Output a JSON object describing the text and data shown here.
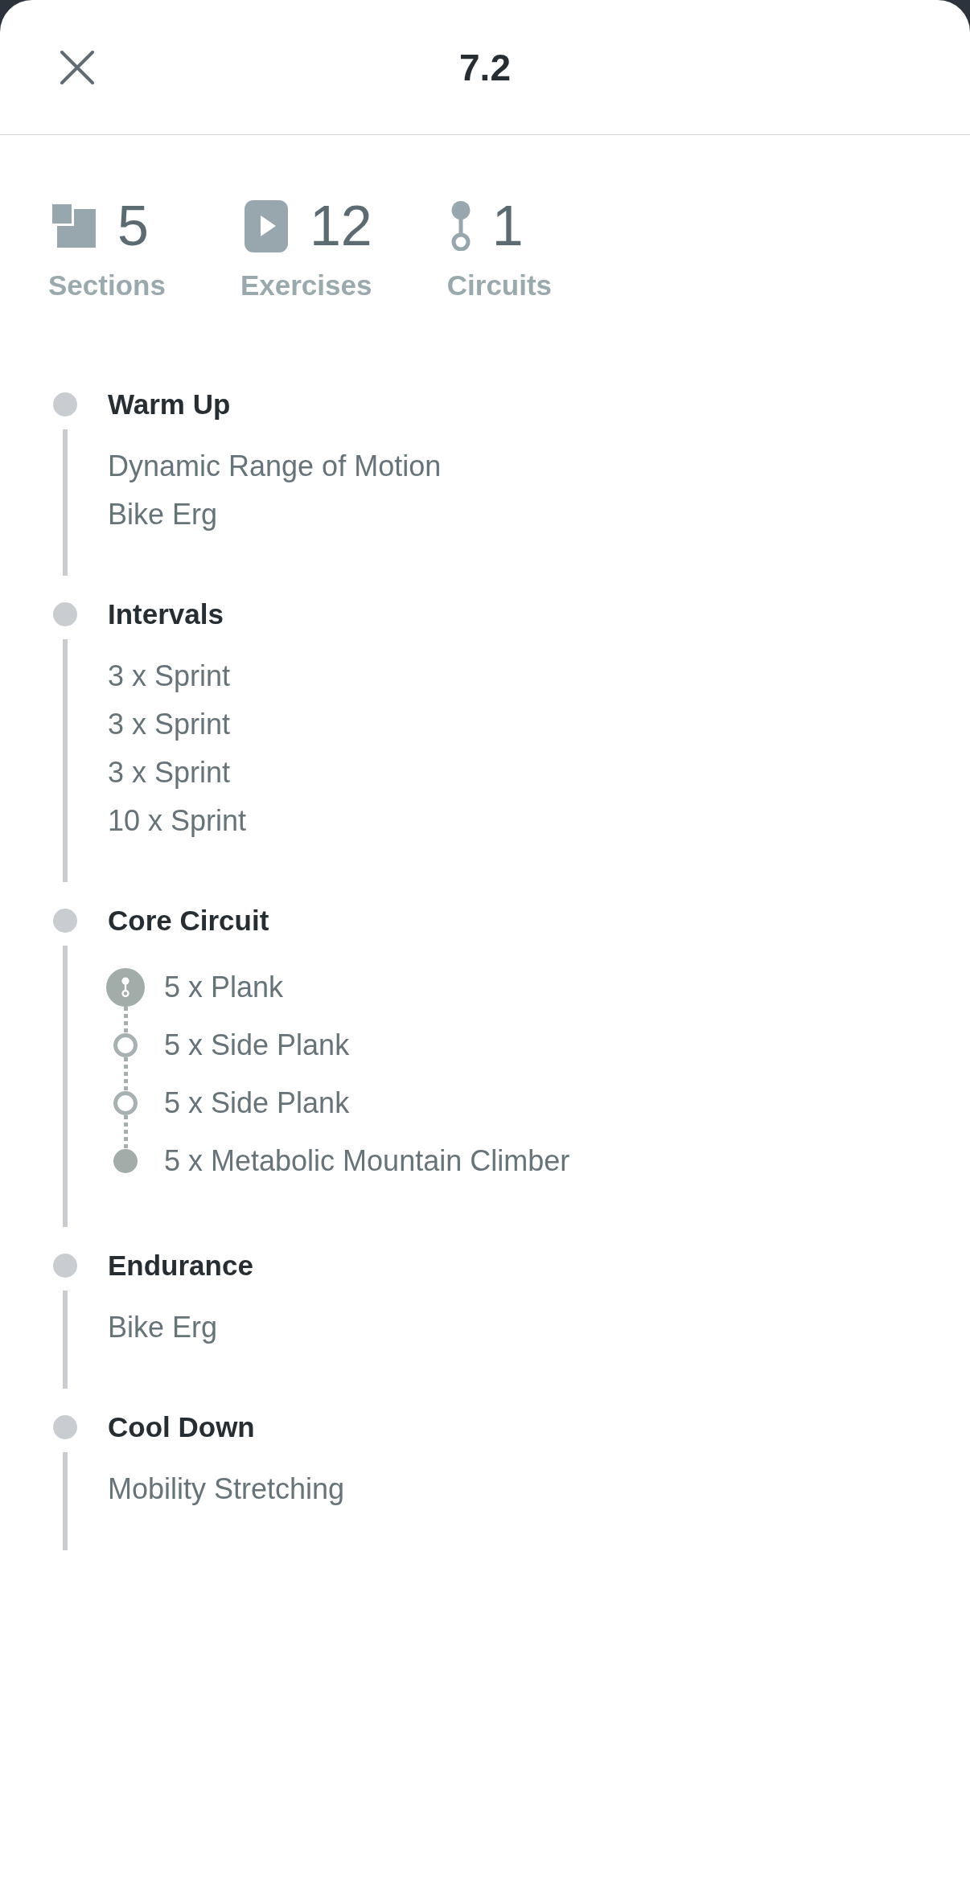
{
  "header": {
    "title": "7.2"
  },
  "stats": [
    {
      "kind": "sections",
      "count": "5",
      "label": "Sections"
    },
    {
      "kind": "exercises",
      "count": "12",
      "label": "Exercises"
    },
    {
      "kind": "circuits",
      "count": "1",
      "label": "Circuits"
    }
  ],
  "sections": [
    {
      "title": "Warm Up",
      "items": [
        {
          "kind": "exercise",
          "name": "Dynamic Range of Motion"
        },
        {
          "kind": "exercise",
          "name": "Bike Erg"
        }
      ]
    },
    {
      "title": "Intervals",
      "items": [
        {
          "kind": "exercise",
          "name": "3 x Sprint"
        },
        {
          "kind": "exercise",
          "name": "3 x Sprint"
        },
        {
          "kind": "exercise",
          "name": "3 x Sprint"
        },
        {
          "kind": "exercise",
          "name": "10 x Sprint"
        }
      ]
    },
    {
      "title": "Core Circuit",
      "items": [
        {
          "kind": "circuit-start",
          "name": "5 x Plank"
        },
        {
          "kind": "circuit-middle",
          "name": "5 x Side Plank"
        },
        {
          "kind": "circuit-middle",
          "name": "5 x Side Plank"
        },
        {
          "kind": "circuit-end",
          "name": "5 x Metabolic Mountain Climber"
        }
      ]
    },
    {
      "title": "Endurance",
      "items": [
        {
          "kind": "exercise",
          "name": "Bike Erg"
        }
      ]
    },
    {
      "title": "Cool Down",
      "items": [
        {
          "kind": "exercise",
          "name": "Mobility Stretching"
        }
      ]
    }
  ]
}
